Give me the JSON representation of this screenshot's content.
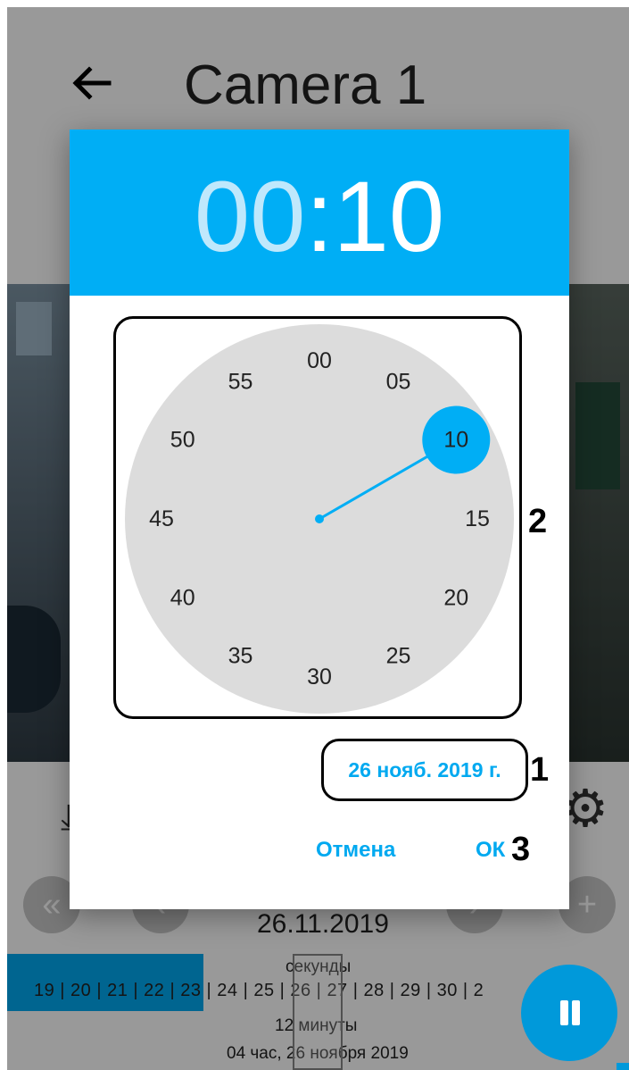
{
  "app_bar": {
    "title": "Camera 1"
  },
  "player": {
    "date": "26.11.2019"
  },
  "timeline": {
    "seconds_label": "секунды",
    "ticks": "19 | 20 | 21 | 22 | 23 | 24 | 25 | 26 | 27 | 28 | 29 | 30 | 2",
    "minutes_label": "12 минуты",
    "hours_label": "04 час, 26 ноября 2019"
  },
  "dialog": {
    "time": {
      "hours": "00",
      "separator": ":",
      "minutes": "10"
    },
    "dial": {
      "numbers": [
        "00",
        "05",
        "10",
        "15",
        "20",
        "25",
        "30",
        "35",
        "40",
        "45",
        "50",
        "55"
      ],
      "selected": "10"
    },
    "date": "26 нояб. 2019 г.",
    "cancel_label": "Отмена",
    "ok_label": "ОК"
  },
  "callouts": {
    "date": "1",
    "dial": "2",
    "ok": "3"
  },
  "colors": {
    "accent": "#00aef5",
    "accent_text": "#00a9f0",
    "dial_bg": "#dcdcdc",
    "fab": "#0099da"
  },
  "icons": {
    "back": "arrow-left-icon",
    "settings": "gear-icon",
    "pause": "pause-icon"
  }
}
